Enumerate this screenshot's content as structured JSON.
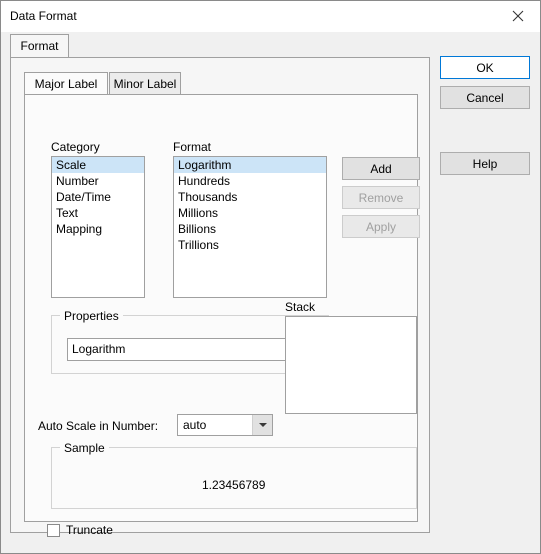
{
  "window": {
    "title": "Data Format",
    "close_icon": "close-icon"
  },
  "outer_tabs": [
    {
      "label": "Format",
      "selected": true
    }
  ],
  "inner_tabs": [
    {
      "label": "Major Label",
      "selected": true
    },
    {
      "label": "Minor Label",
      "selected": false
    }
  ],
  "category": {
    "label": "Category",
    "items": [
      "Scale",
      "Number",
      "Date/Time",
      "Text",
      "Mapping"
    ],
    "selected": "Scale"
  },
  "format": {
    "label": "Format",
    "items": [
      "Logarithm",
      "Hundreds",
      "Thousands",
      "Millions",
      "Billions",
      "Trillions"
    ],
    "selected": "Logarithm"
  },
  "format_buttons": [
    {
      "label": "Add",
      "enabled": true
    },
    {
      "label": "Remove",
      "enabled": false
    },
    {
      "label": "Apply",
      "enabled": false
    }
  ],
  "properties": {
    "label": "Properties",
    "value": "Logarithm",
    "placeholder": ""
  },
  "stack": {
    "label": "Stack",
    "items": []
  },
  "auto_scale": {
    "label": "Auto Scale in Number:",
    "value": "auto",
    "options": [
      "auto"
    ]
  },
  "sample": {
    "label": "Sample",
    "value": "1.23456789"
  },
  "truncate": {
    "label": "Truncate",
    "checked": false
  },
  "dialog_buttons": [
    {
      "label": "OK",
      "primary": true
    },
    {
      "label": "Cancel",
      "primary": false
    },
    {
      "label": "Help",
      "primary": false
    }
  ],
  "colors": {
    "accent": "#0078d7",
    "selection": "#cce4f7",
    "panel": "#fbfbfb",
    "window": "#f0f0f0"
  }
}
